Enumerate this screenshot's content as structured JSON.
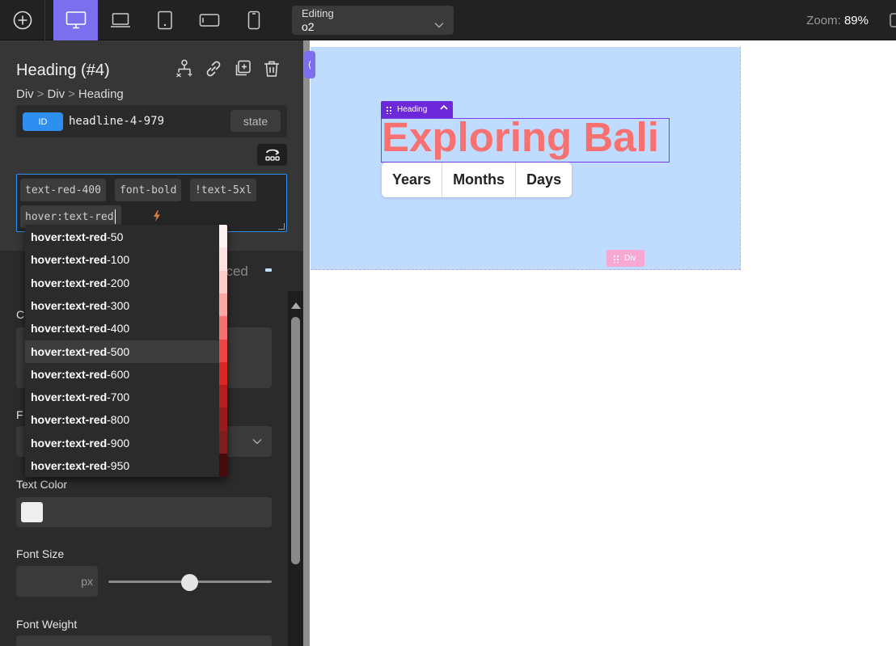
{
  "toolbar": {
    "devices": [
      "desktop",
      "laptop",
      "tablet",
      "tablet-landscape",
      "phone"
    ],
    "editing_label": "Editing",
    "editing_value": "o2",
    "zoom_label": "Zoom:",
    "zoom_value": "89%"
  },
  "panel": {
    "title": "Heading (#4)",
    "breadcrumb": [
      "Div",
      "Div",
      "Heading"
    ],
    "id_badge": "ID",
    "id_value": "headline-4-979",
    "state_label": "state",
    "classes": [
      "text-red-400",
      "font-bold",
      "!text-5xl"
    ],
    "class_input": "hover:text-red",
    "tab_partial": "nced",
    "labels": {
      "c_partial": "C",
      "f_partial": "F",
      "text_color": "Text Color",
      "font_size": "Font Size",
      "font_size_unit": "px",
      "font_weight": "Font Weight"
    },
    "font_size_slider": 0.5
  },
  "autocomplete": {
    "prefix": "hover:text-red",
    "items": [
      {
        "suffix": "-50",
        "color": "#fef2f2"
      },
      {
        "suffix": "-100",
        "color": "#fee2e2"
      },
      {
        "suffix": "-200",
        "color": "#fecaca"
      },
      {
        "suffix": "-300",
        "color": "#fca5a5"
      },
      {
        "suffix": "-400",
        "color": "#f87171"
      },
      {
        "suffix": "-500",
        "color": "#ef4444"
      },
      {
        "suffix": "-600",
        "color": "#dc2626"
      },
      {
        "suffix": "-700",
        "color": "#b91c1c"
      },
      {
        "suffix": "-800",
        "color": "#991b1b"
      },
      {
        "suffix": "-900",
        "color": "#7f1d1d"
      },
      {
        "suffix": "-950",
        "color": "#450a0a"
      }
    ],
    "highlighted_index": 5
  },
  "canvas": {
    "heading_label": "Heading",
    "heading_text": "Exploring Bali",
    "tabs": [
      "Years",
      "Months",
      "Days"
    ],
    "div_label": "Div",
    "colors": {
      "background": "#bfdbfe",
      "heading": "#f87171",
      "selection": "#7c3aed"
    }
  }
}
